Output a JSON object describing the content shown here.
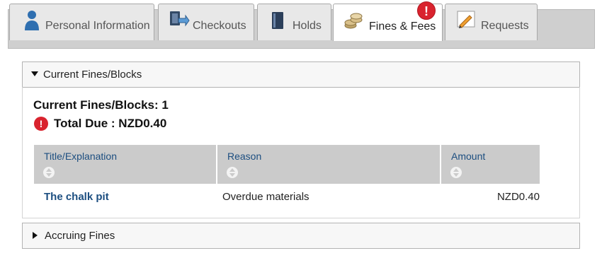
{
  "tabs": [
    {
      "label": "Personal Information",
      "icon": "person-icon",
      "active": false
    },
    {
      "label": "Checkouts",
      "icon": "checkout-icon",
      "active": false
    },
    {
      "label": "Holds",
      "icon": "book-icon",
      "active": false
    },
    {
      "label": "Fines & Fees",
      "icon": "coins-icon",
      "active": true,
      "badge": "!"
    },
    {
      "label": "Requests",
      "icon": "pencil-icon",
      "active": false
    }
  ],
  "current_section": {
    "header": "Current Fines/Blocks",
    "count_text": "Current Fines/Blocks: 1",
    "total_due_text": "Total Due : NZD0.40",
    "alert_glyph": "!"
  },
  "table": {
    "columns": [
      "Title/Explanation",
      "Reason",
      "Amount"
    ],
    "rows": [
      {
        "title": "The chalk pit",
        "reason": "Overdue materials",
        "amount": "NZD0.40"
      }
    ]
  },
  "accruing_section": {
    "header": "Accruing Fines"
  },
  "colors": {
    "link": "#1c4e80",
    "alert": "#d9232e",
    "table_header": "#cbcbcb"
  }
}
